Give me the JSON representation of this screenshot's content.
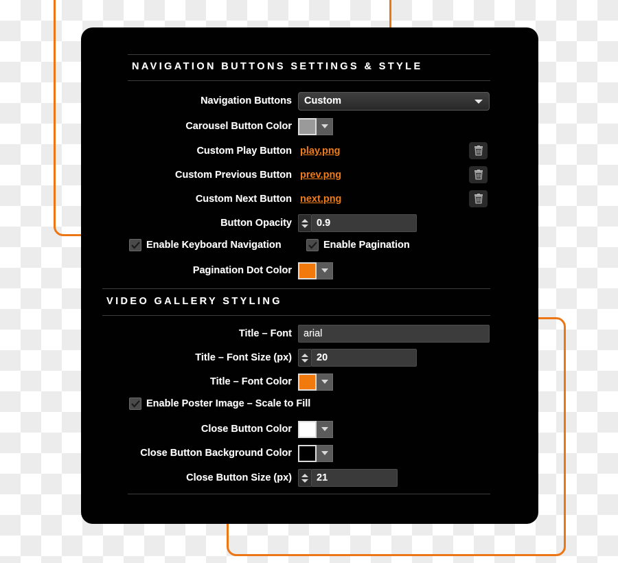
{
  "panel": {
    "sections": [
      {
        "id": "navigation-buttons",
        "title": "NAVIGATION BUTTONS SETTINGS & STYLE"
      },
      {
        "id": "video-gallery-styling",
        "title": "VIDEO GALLERY STYLING"
      }
    ]
  },
  "nav_section": {
    "navigation_buttons": {
      "label": "Navigation Buttons",
      "value": "Custom",
      "icon": "chevron-down-icon"
    },
    "carousel_button_color": {
      "label": "Carousel Button Color",
      "color": "#9a9a9a",
      "icon": "chevron-down-icon"
    },
    "custom_play_button": {
      "label": "Custom Play Button",
      "file": "play.png",
      "delete_icon": "trash-icon"
    },
    "custom_previous_button": {
      "label": "Custom Previous Button",
      "file": "prev.png",
      "delete_icon": "trash-icon"
    },
    "custom_next_button": {
      "label": "Custom Next Button",
      "file": "next.png",
      "delete_icon": "trash-icon"
    },
    "button_opacity": {
      "label": "Button Opacity",
      "value": "0.9"
    },
    "enable_keyboard_navigation": {
      "label": "Enable Keyboard Navigation",
      "checked": true
    },
    "enable_pagination": {
      "label": "Enable Pagination",
      "checked": true
    },
    "pagination_dot_color": {
      "label": "Pagination Dot Color",
      "color": "#f2790d",
      "icon": "chevron-down-icon"
    }
  },
  "gallery_section": {
    "title_font": {
      "label": "Title – Font",
      "value": "arial"
    },
    "title_font_size": {
      "label": "Title – Font Size (px)",
      "value": "20"
    },
    "title_font_color": {
      "label": "Title – Font Color",
      "color": "#f2790d",
      "icon": "chevron-down-icon"
    },
    "enable_poster_image": {
      "label": "Enable Poster Image – Scale to Fill",
      "checked": true
    },
    "close_button_color": {
      "label": "Close Button Color",
      "color": "#ffffff",
      "icon": "chevron-down-icon"
    },
    "close_button_background_color": {
      "label": "Close Button Background Color",
      "color": "#000000",
      "icon": "chevron-down-icon"
    },
    "close_button_size": {
      "label": "Close Button Size (px)",
      "value": "21"
    }
  },
  "theme": {
    "accent_orange": "#ed7614",
    "panel_background": "#010101",
    "label_text": "#ffffff",
    "input_background": "#3a3a3a",
    "divider": "#3d3d3d"
  }
}
